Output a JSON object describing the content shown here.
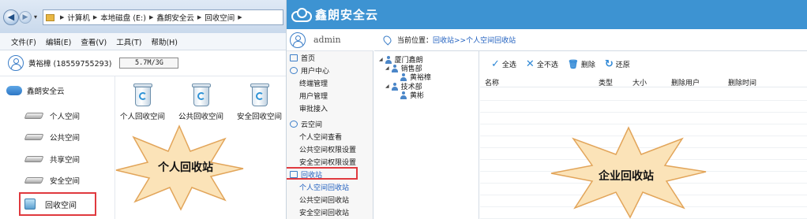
{
  "explorer": {
    "address_crumbs": [
      "计算机",
      "本地磁盘 (E:)",
      "鑫朗安全云",
      "回收空间"
    ],
    "menu": [
      "文件(F)",
      "编辑(E)",
      "查看(V)",
      "工具(T)",
      "帮助(H)"
    ],
    "user_name": "黄裕樟 (18559755293)",
    "quota": "5.7M/3G",
    "tree_root": "鑫朗安全云",
    "tree_items": [
      "个人空间",
      "公共空间",
      "共享空间",
      "安全空间",
      "回收空间"
    ],
    "files": [
      "个人回收空间",
      "公共回收空间",
      "安全回收空间"
    ],
    "callout": "个人回收站"
  },
  "web": {
    "brand": "鑫朗安全云",
    "admin": "admin",
    "location_label": "当前位置：",
    "location_value": "回收站>>个人空间回收站",
    "sidebar": [
      {
        "label": "首页",
        "kind": "sec"
      },
      {
        "label": "用户中心",
        "kind": "sec"
      },
      {
        "label": "终端管理",
        "kind": "sub"
      },
      {
        "label": "用户管理",
        "kind": "sub"
      },
      {
        "label": "审批接入",
        "kind": "sub"
      },
      {
        "label": "云空间",
        "kind": "sec"
      },
      {
        "label": "个人空间查看",
        "kind": "sub"
      },
      {
        "label": "公共空间权限设置",
        "kind": "sub"
      },
      {
        "label": "安全空间权限设置",
        "kind": "sub"
      },
      {
        "label": "回收站",
        "kind": "sec"
      },
      {
        "label": "个人空间回收站",
        "kind": "sub"
      },
      {
        "label": "公共空间回收站",
        "kind": "sub"
      },
      {
        "label": "安全空间回收站",
        "kind": "sub"
      }
    ],
    "org_tree": [
      "厦门鑫朗",
      "销售部",
      "黄裕樟",
      "技术部",
      "黄彬"
    ],
    "toolbar": [
      {
        "glyph": "✓",
        "label": "全选"
      },
      {
        "glyph": "✕",
        "label": "全不选"
      },
      {
        "glyph": "🗑",
        "label": "删除"
      },
      {
        "glyph": "↻",
        "label": "还原"
      }
    ],
    "columns": [
      "名称",
      "类型",
      "大小",
      "删除用户",
      "删除时间"
    ],
    "callout": "企业回收站"
  },
  "colors": {
    "accent_blue": "#3d93d2",
    "highlight_red": "#e0393e",
    "callout_fill": "#fbe3b8",
    "callout_stroke": "#e2a55a"
  }
}
